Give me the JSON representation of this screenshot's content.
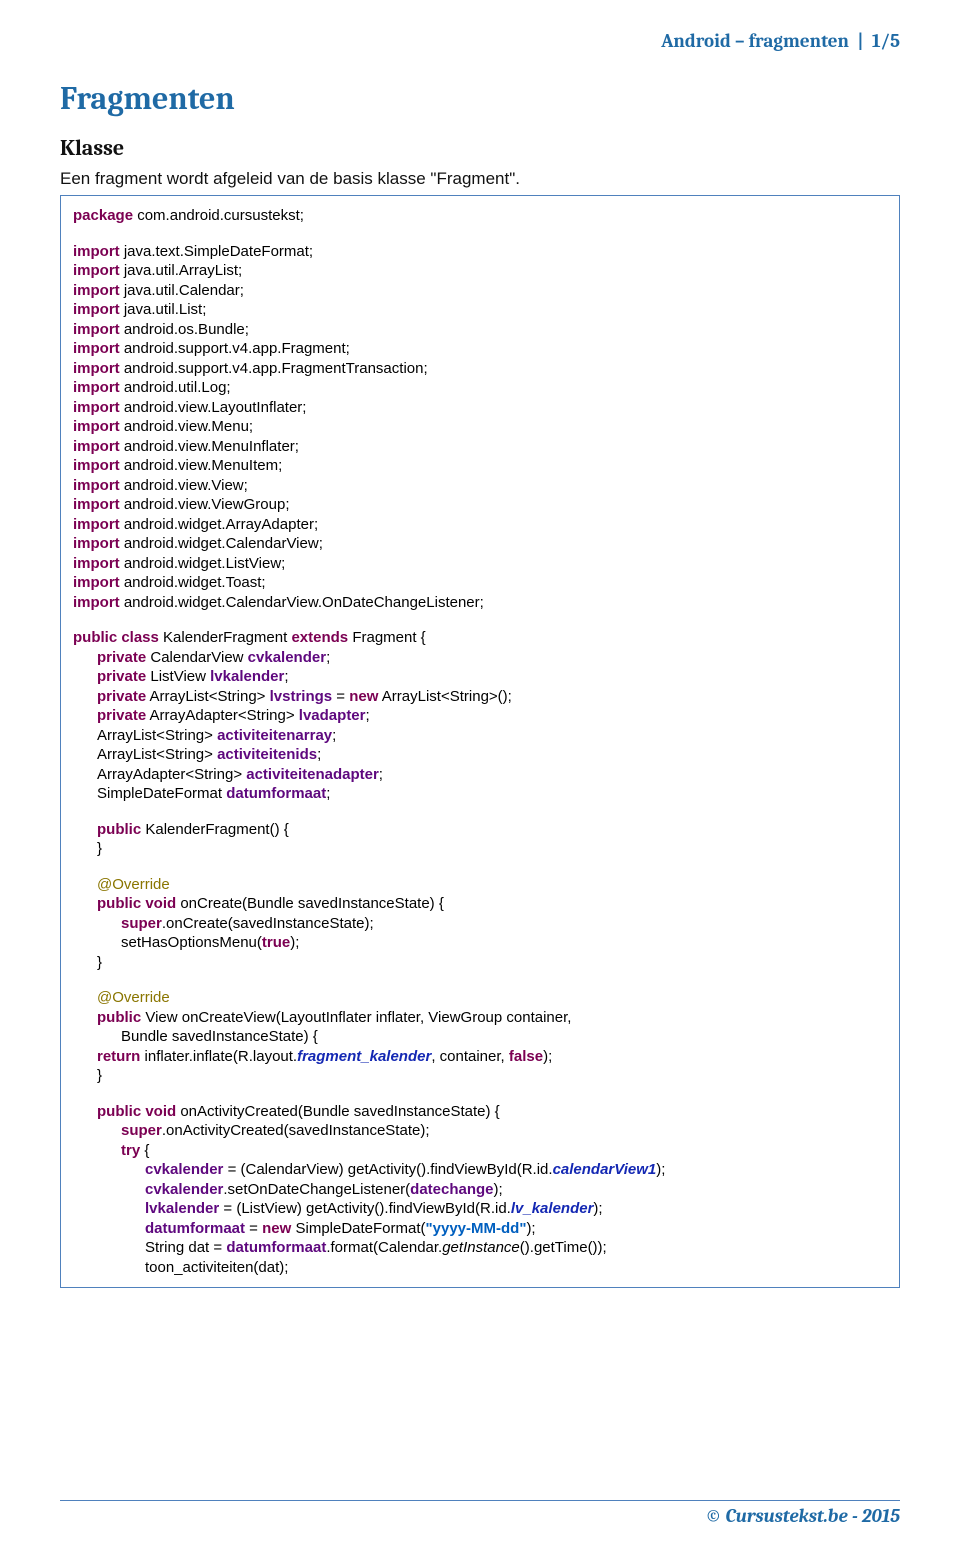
{
  "header": {
    "text": "Android – fragmenten",
    "page": "1/5"
  },
  "title": "Fragmenten",
  "subtitle": "Klasse",
  "intro": "Een fragment wordt afgeleid van de basis klasse \"Fragment\".",
  "footer": "© Cursustekst.be - 2015",
  "code": {
    "pkg": "com.android.cursustekst;",
    "imports": [
      "java.text.SimpleDateFormat;",
      "java.util.ArrayList;",
      "java.util.Calendar;",
      "java.util.List;",
      "android.os.Bundle;",
      "android.support.v4.app.Fragment;",
      "android.support.v4.app.FragmentTransaction;",
      "android.util.Log;",
      "android.view.LayoutInflater;",
      "android.view.Menu;",
      "android.view.MenuInflater;",
      "android.view.MenuItem;",
      "android.view.View;",
      "android.view.ViewGroup;",
      "android.widget.ArrayAdapter;",
      "android.widget.CalendarView;",
      "android.widget.ListView;",
      "android.widget.Toast;",
      "android.widget.CalendarView.OnDateChangeListener;"
    ],
    "classdecl": {
      "p1": "KalenderFragment",
      "p2": "Fragment {"
    },
    "fields": {
      "f1a": "CalendarView",
      "f1b": "cvkalender",
      "f2a": "ListView",
      "f2b": "lvkalender",
      "f3a": "ArrayList<String>",
      "f3b": "lvstrings",
      "f3c": "ArrayList<String>();",
      "f4a": "ArrayAdapter<String>",
      "f4b": "lvadapter",
      "f5a": "ArrayList<String>",
      "f5b": "activiteitenarray",
      "f6a": "ArrayList<String>",
      "f6b": "activiteitenids",
      "f7a": "ArrayAdapter<String>",
      "f7b": "activiteitenadapter",
      "f8a": "SimpleDateFormat",
      "f8b": "datumformaat"
    },
    "ctor": "KalenderFragment() {",
    "override": "@Override",
    "m1": "onCreate(Bundle savedInstanceState) {",
    "m1a": ".onCreate(savedInstanceState);",
    "m1b": "setHasOptionsMenu(",
    "m2a": "View onCreateView(LayoutInflater inflater, ViewGroup container,",
    "m2b": "Bundle savedInstanceState) {",
    "m2c": "inflater.inflate(R.layout.",
    "m2d": "fragment_kalender",
    "m2e": ", container,",
    "m3": "onActivityCreated(Bundle savedInstanceState) {",
    "m3a": ".onActivityCreated(savedInstanceState);",
    "m3b": "= (CalendarView) getActivity().findViewById(R.id.",
    "m3b2": "calendarView1",
    "m3c": ".setOnDateChangeListener(",
    "m3c2": "datechange",
    "m3d": "= (ListView) getActivity().findViewById(R.id.",
    "m3d2": "lv_kalender",
    "m3e": "SimpleDateFormat(",
    "m3e2": "\"yyyy-MM-dd\"",
    "m3f": "String dat =",
    "m3f2": ".format(Calendar.",
    "m3f3": "getInstance",
    "m3f4": "().getTime());",
    "m3g": "toon_activiteiten(dat);"
  }
}
